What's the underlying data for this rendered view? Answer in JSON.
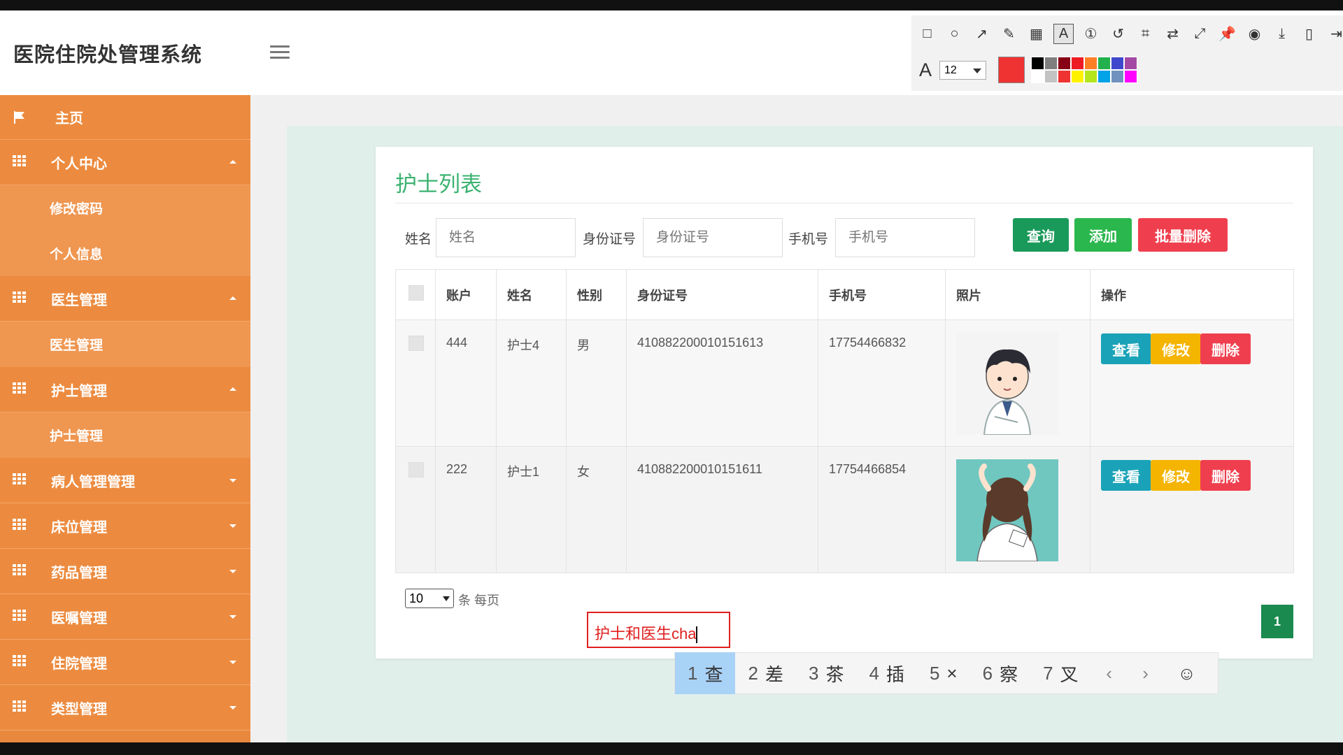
{
  "app": {
    "title": "医院住院处管理系统"
  },
  "annotation_toolbar": {
    "tools": [
      "rectangle-tool-icon",
      "ellipse-tool-icon",
      "arrow-tool-icon",
      "pencil-tool-icon",
      "mosaic-tool-icon",
      "text-tool-icon",
      "number-tool-icon",
      "undo-icon",
      "crop-icon",
      "translate-icon",
      "expand-icon",
      "pin-icon",
      "record-icon",
      "download-icon",
      "save-icon",
      "exit-icon"
    ],
    "font_size": "12",
    "current_color": "#ef3333",
    "palette": [
      "#000000",
      "#7f7f7f",
      "#880015",
      "#ed1c24",
      "#ff7f27",
      "#22b14c",
      "#3f48cc",
      "#a349a4",
      "#ffffff",
      "#c3c3c3",
      "#ef3333",
      "#fff200",
      "#b5e61d",
      "#00a2e8",
      "#7092be",
      "#ff00ff"
    ]
  },
  "sidebar": {
    "items": [
      {
        "label": "主页",
        "type": "top",
        "icon": "flag-icon"
      },
      {
        "label": "个人中心",
        "type": "top",
        "icon": "grid-icon",
        "expanded": true
      },
      {
        "label": "修改密码",
        "type": "sub"
      },
      {
        "label": "个人信息",
        "type": "sub"
      },
      {
        "label": "医生管理",
        "type": "top",
        "icon": "grid-icon",
        "expanded": true
      },
      {
        "label": "医生管理",
        "type": "sub"
      },
      {
        "label": "护士管理",
        "type": "top",
        "icon": "grid-icon",
        "expanded": true
      },
      {
        "label": "护士管理",
        "type": "sub"
      },
      {
        "label": "病人管理管理",
        "type": "top",
        "icon": "grid-icon",
        "expanded": false
      },
      {
        "label": "床位管理",
        "type": "top",
        "icon": "grid-icon",
        "expanded": false
      },
      {
        "label": "药品管理",
        "type": "top",
        "icon": "grid-icon",
        "expanded": false
      },
      {
        "label": "医嘱管理",
        "type": "top",
        "icon": "grid-icon",
        "expanded": false
      },
      {
        "label": "住院管理",
        "type": "top",
        "icon": "grid-icon",
        "expanded": false
      },
      {
        "label": "类型管理",
        "type": "top",
        "icon": "grid-icon",
        "expanded": false
      }
    ]
  },
  "main": {
    "title": "护士列表",
    "search": {
      "name_label": "姓名",
      "name_placeholder": "姓名",
      "id_label": "身份证号",
      "id_placeholder": "身份证号",
      "phone_label": "手机号",
      "phone_placeholder": "手机号",
      "query_button": "查询",
      "add_button": "添加",
      "batch_delete_button": "批量删除"
    },
    "table": {
      "headers": [
        "账户",
        "姓名",
        "性别",
        "身份证号",
        "手机号",
        "照片",
        "操作"
      ],
      "rows": [
        {
          "account": "444",
          "name": "护士4",
          "gender": "男",
          "id_number": "410882200010151613",
          "phone": "17754466832"
        },
        {
          "account": "222",
          "name": "护士1",
          "gender": "女",
          "id_number": "410882200010151611",
          "phone": "17754466854"
        }
      ],
      "actions": {
        "view": "查看",
        "edit": "修改",
        "delete": "删除"
      }
    },
    "pagination": {
      "page_size": "10",
      "page_size_label": "条 每页",
      "current_page": "1"
    }
  },
  "ime": {
    "composition": "护士和医生cha",
    "candidates": [
      {
        "num": "1",
        "char": "查"
      },
      {
        "num": "2",
        "char": "差"
      },
      {
        "num": "3",
        "char": "茶"
      },
      {
        "num": "4",
        "char": "插"
      },
      {
        "num": "5",
        "char": "×"
      },
      {
        "num": "6",
        "char": "察"
      },
      {
        "num": "7",
        "char": "叉"
      }
    ],
    "prev": "‹",
    "next": "›",
    "emoji": "☺"
  },
  "colors": {
    "sidebar": "#e9883d",
    "accent_green": "#3cb371",
    "danger": "#ef3f4e",
    "warning": "#f5b400",
    "info": "#1aa3b8"
  }
}
